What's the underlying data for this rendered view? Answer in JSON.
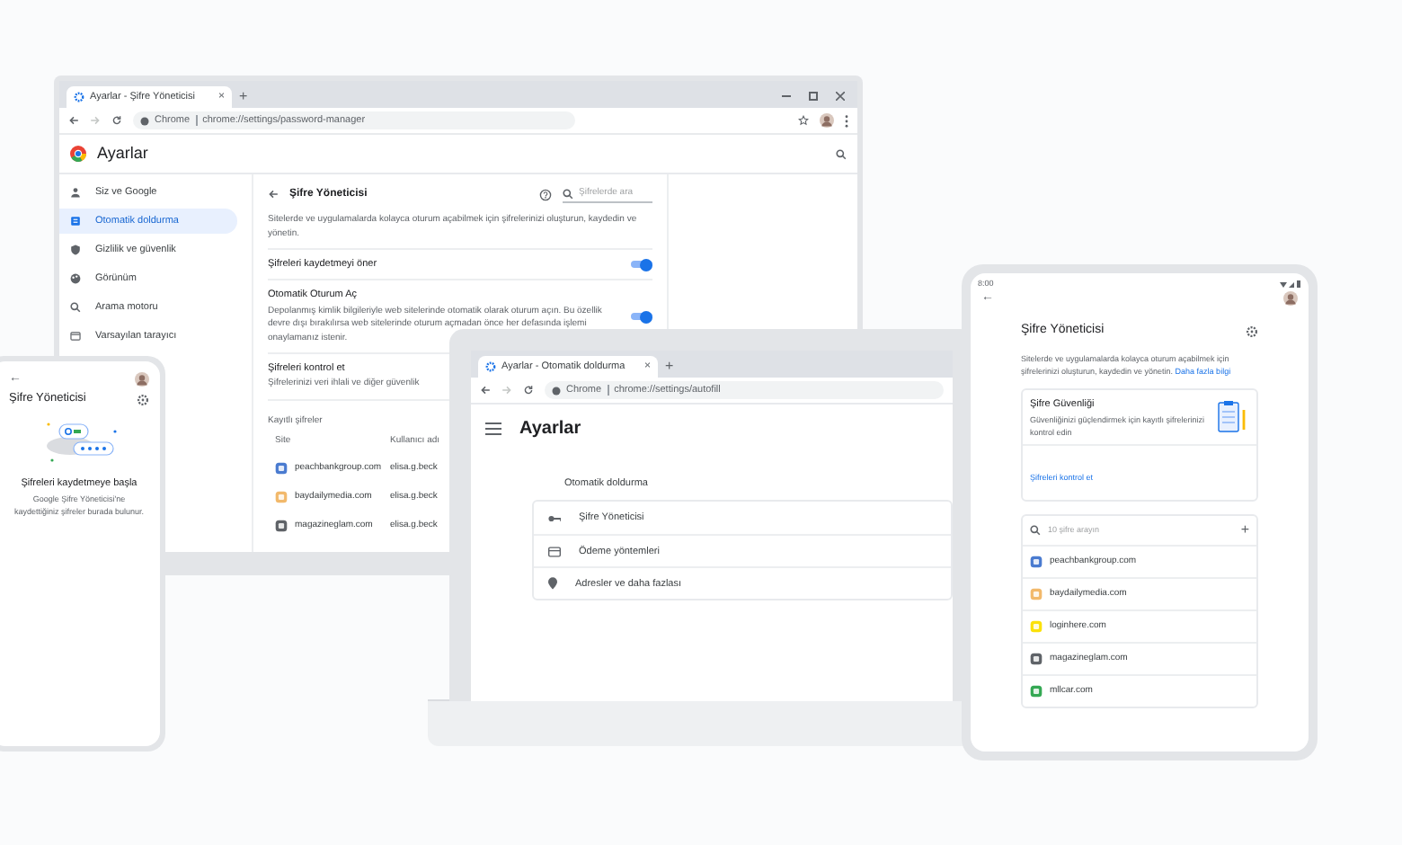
{
  "desktop": {
    "tab": {
      "title": "Ayarlar - Şifre Yöneticisi",
      "close": "×"
    },
    "new_tab": "+",
    "address": {
      "scheme": "Chrome",
      "url": "chrome://settings/password-manager"
    },
    "header": {
      "title": "Ayarlar"
    },
    "sidebar": {
      "items": [
        {
          "label": "Siz ve Google",
          "selected": false
        },
        {
          "label": "Otomatik doldurma",
          "selected": true
        },
        {
          "label": "Gizlilik ve güvenlik",
          "selected": false
        },
        {
          "label": "Görünüm",
          "selected": false
        },
        {
          "label": "Arama motoru",
          "selected": false
        },
        {
          "label": "Varsayılan tarayıcı",
          "selected": false
        }
      ]
    },
    "page": {
      "title": "Şifre Yöneticisi",
      "search_placeholder": "Şifrelerde ara",
      "description": "Sitelerde ve uygulamalarda kolayca oturum açabilmek için şifrelerinizi oluşturun, kaydedin ve yönetin.",
      "settings": [
        {
          "kind": "toggle",
          "label": "Şifreleri kaydetmeyi öner",
          "on": true
        },
        {
          "kind": "toggle",
          "label": "Otomatik Oturum Aç",
          "description": "Depolanmış kimlik bilgileriyle web sitelerinde otomatik olarak oturum açın. Bu özellik devre dışı bırakılırsa web sitelerinde oturum açmadan önce her defasında işlemi onaylamanız istenir.",
          "on": true
        },
        {
          "kind": "link",
          "label": "Şifreleri kontrol et",
          "description": "Şifrelerinizi veri ihlali ve diğer güvenlik"
        }
      ],
      "saved_title": "Kayıtlı şifreler",
      "columns": [
        "Site",
        "Kullanıcı adı"
      ],
      "rows": [
        {
          "site": "peachbankgroup.com",
          "user": "elisa.g.beck",
          "color": "#4a7bd0"
        },
        {
          "site": "baydailymedia.com",
          "user": "elisa.g.beck",
          "color": "#f2b96b"
        },
        {
          "site": "magazineglam.com",
          "user": "elisa.g.beck",
          "color": "#5f6368"
        }
      ]
    }
  },
  "phone": {
    "back": "←",
    "title": "Şifre Yöneticisi",
    "empty_title": "Şifreleri kaydetmeye başla",
    "empty_text": "Google Şifre Yöneticisi'ne kaydettiğiniz şifreler burada bulunur."
  },
  "laptop": {
    "tab": {
      "title": "Ayarlar - Otomatik doldurma",
      "close": "×"
    },
    "new_tab": "+",
    "address": {
      "scheme": "Chrome",
      "url": "chrome://settings/autofill"
    },
    "header": {
      "title": "Ayarlar"
    },
    "section": "Otomatik doldurma",
    "items": [
      {
        "kind": "key",
        "label": "Şifre Yöneticisi"
      },
      {
        "kind": "card",
        "label": "Ödeme yöntemleri"
      },
      {
        "kind": "pin",
        "label": "Adresler ve daha fazlası"
      }
    ]
  },
  "tablet": {
    "time": "8:00",
    "back": "←",
    "title": "Şifre Yöneticisi",
    "description": "Sitelerde ve uygulamalarda kolayca oturum açabilmek için şifrelerinizi oluşturun, kaydedin ve yönetin.",
    "learn_more": "Daha fazla bilgi",
    "checkup": {
      "title": "Şifre Güvenliği",
      "text": "Güvenliğinizi güçlendirmek için kayıtlı şifrelerinizi kontrol edin",
      "link": "Şifreleri kontrol et"
    },
    "search_placeholder": "10 şifre arayın",
    "add": "+",
    "sites": [
      {
        "site": "peachbankgroup.com",
        "color": "#4a7bd0"
      },
      {
        "site": "baydailymedia.com",
        "color": "#f2b96b"
      },
      {
        "site": "loginhere.com",
        "color": "#fbe10a"
      },
      {
        "site": "magazineglam.com",
        "color": "#5f6368"
      },
      {
        "site": "mllcar.com",
        "color": "#34a853"
      }
    ]
  }
}
